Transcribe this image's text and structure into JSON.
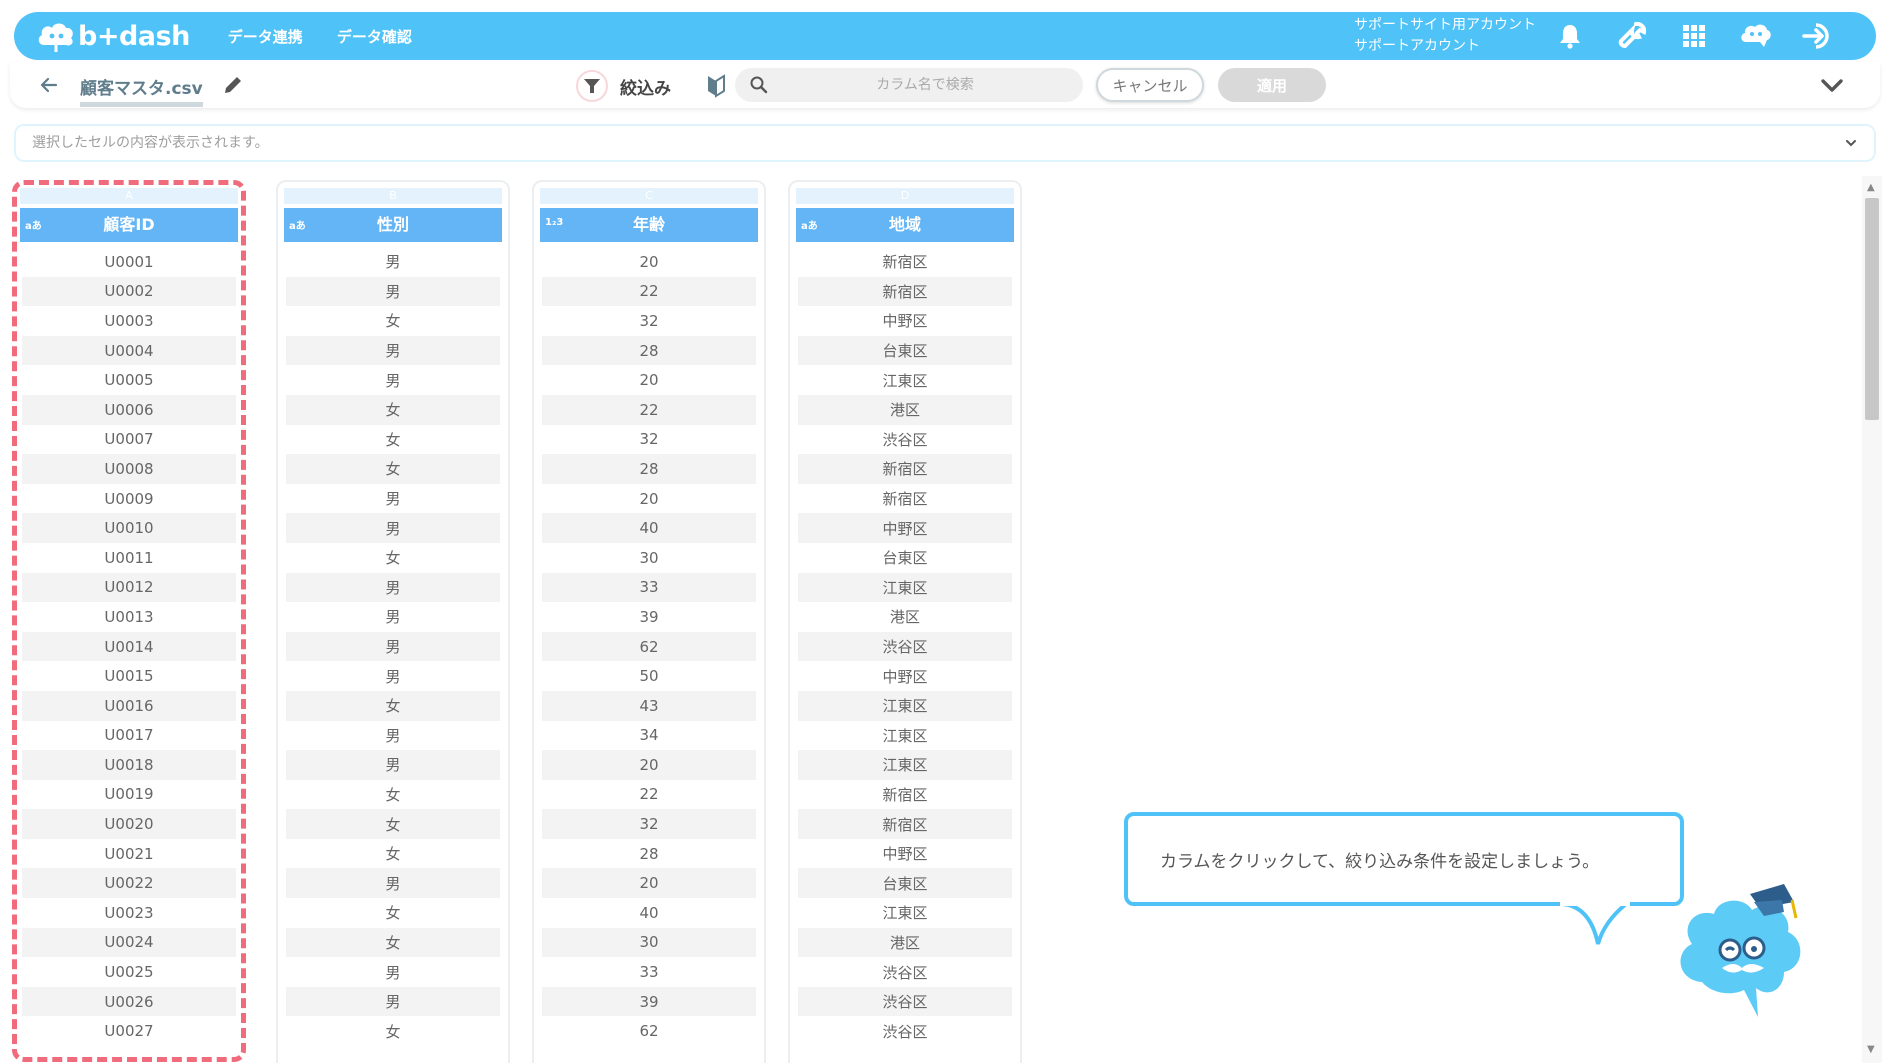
{
  "header": {
    "logo_text": "b+dash",
    "nav": [
      "データ連携",
      "データ確認"
    ],
    "account_line1": "サポートサイト用アカウント",
    "account_line2": "サポートアカウント",
    "icons": [
      "bell-icon",
      "wrench-icon",
      "grid-icon",
      "brain-icon",
      "logout-icon"
    ]
  },
  "toolbar": {
    "filename": "顧客マスタ.csv",
    "filter_label": "絞込み",
    "search_placeholder": "カラム名で検索",
    "cancel_label": "キャンセル",
    "apply_label": "適用"
  },
  "cellbar": {
    "placeholder": "選択したセルの内容が表示されます。"
  },
  "columns": [
    {
      "letter": "A",
      "type": "aあ",
      "name": "顧客ID",
      "selected": true,
      "values": [
        "U0001",
        "U0002",
        "U0003",
        "U0004",
        "U0005",
        "U0006",
        "U0007",
        "U0008",
        "U0009",
        "U0010",
        "U0011",
        "U0012",
        "U0013",
        "U0014",
        "U0015",
        "U0016",
        "U0017",
        "U0018",
        "U0019",
        "U0020",
        "U0021",
        "U0022",
        "U0023",
        "U0024",
        "U0025",
        "U0026",
        "U0027"
      ]
    },
    {
      "letter": "B",
      "type": "aあ",
      "name": "性別",
      "selected": false,
      "values": [
        "男",
        "男",
        "女",
        "男",
        "男",
        "女",
        "女",
        "女",
        "男",
        "男",
        "女",
        "男",
        "男",
        "男",
        "男",
        "女",
        "男",
        "男",
        "女",
        "女",
        "女",
        "男",
        "女",
        "女",
        "男",
        "男",
        "女"
      ]
    },
    {
      "letter": "C",
      "type": "1₂3",
      "name": "年齢",
      "selected": false,
      "values": [
        "20",
        "22",
        "32",
        "28",
        "20",
        "22",
        "32",
        "28",
        "20",
        "40",
        "30",
        "33",
        "39",
        "62",
        "50",
        "43",
        "34",
        "20",
        "22",
        "32",
        "28",
        "20",
        "40",
        "30",
        "33",
        "39",
        "62"
      ]
    },
    {
      "letter": "D",
      "type": "aあ",
      "name": "地域",
      "selected": false,
      "values": [
        "新宿区",
        "新宿区",
        "中野区",
        "台東区",
        "江東区",
        "港区",
        "渋谷区",
        "新宿区",
        "新宿区",
        "中野区",
        "台東区",
        "江東区",
        "港区",
        "渋谷区",
        "中野区",
        "江東区",
        "江東区",
        "江東区",
        "新宿区",
        "新宿区",
        "中野区",
        "台東区",
        "江東区",
        "港区",
        "渋谷区",
        "渋谷区",
        "渋谷区"
      ]
    }
  ],
  "tooltip": {
    "message": "カラムをクリックして、絞り込み条件を設定しましょう。"
  },
  "colors": {
    "header_bg": "#4fc3f7",
    "column_header_bg": "#64b5f6",
    "selected_outline": "#f06b7b"
  }
}
